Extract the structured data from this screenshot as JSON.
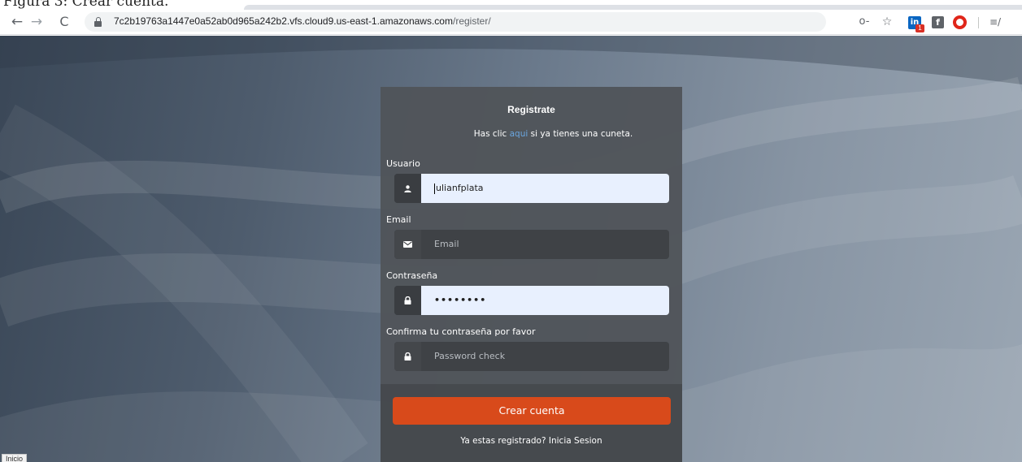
{
  "browser": {
    "url_host": "7c2b19763a1447e0a52ab0d965a242b2.vfs.cloud9.us-east-1.amazonaws.com",
    "url_path": "/register/",
    "back_icon": "←",
    "forward_icon": "→",
    "reload_icon": "C",
    "key_icon": "o-",
    "star_icon": "☆",
    "linkedin_letters": "in",
    "linkedin_badge": "1",
    "facebook_letter": "f",
    "menu_icon": "≡/"
  },
  "top_strip": {
    "cut_text": "Figura 3: Crear cuenta."
  },
  "form": {
    "title": "Registrate",
    "subtitle_prefix": "Has clic ",
    "subtitle_link": "aqui",
    "subtitle_suffix": " si ya tienes una cuneta.",
    "username": {
      "label": "Usuario",
      "value": "ulianfplata",
      "icon": "user-icon"
    },
    "email": {
      "label": "Email",
      "placeholder": "Email",
      "icon": "envelope-icon"
    },
    "password": {
      "label": "Contraseña",
      "value": "••••••••",
      "icon": "lock-icon"
    },
    "password_check": {
      "label": "Confirma tu contraseña por favor",
      "placeholder": "Password check",
      "icon": "lock-icon"
    },
    "submit_label": "Crear cuenta",
    "login_link": "Ya estas registrado? Inicia Sesion"
  },
  "status_bar": {
    "text": "Inicio"
  },
  "colors": {
    "accent": "#d84a1b",
    "link": "#6aa6e0",
    "autofill": "#e8f0fe"
  }
}
